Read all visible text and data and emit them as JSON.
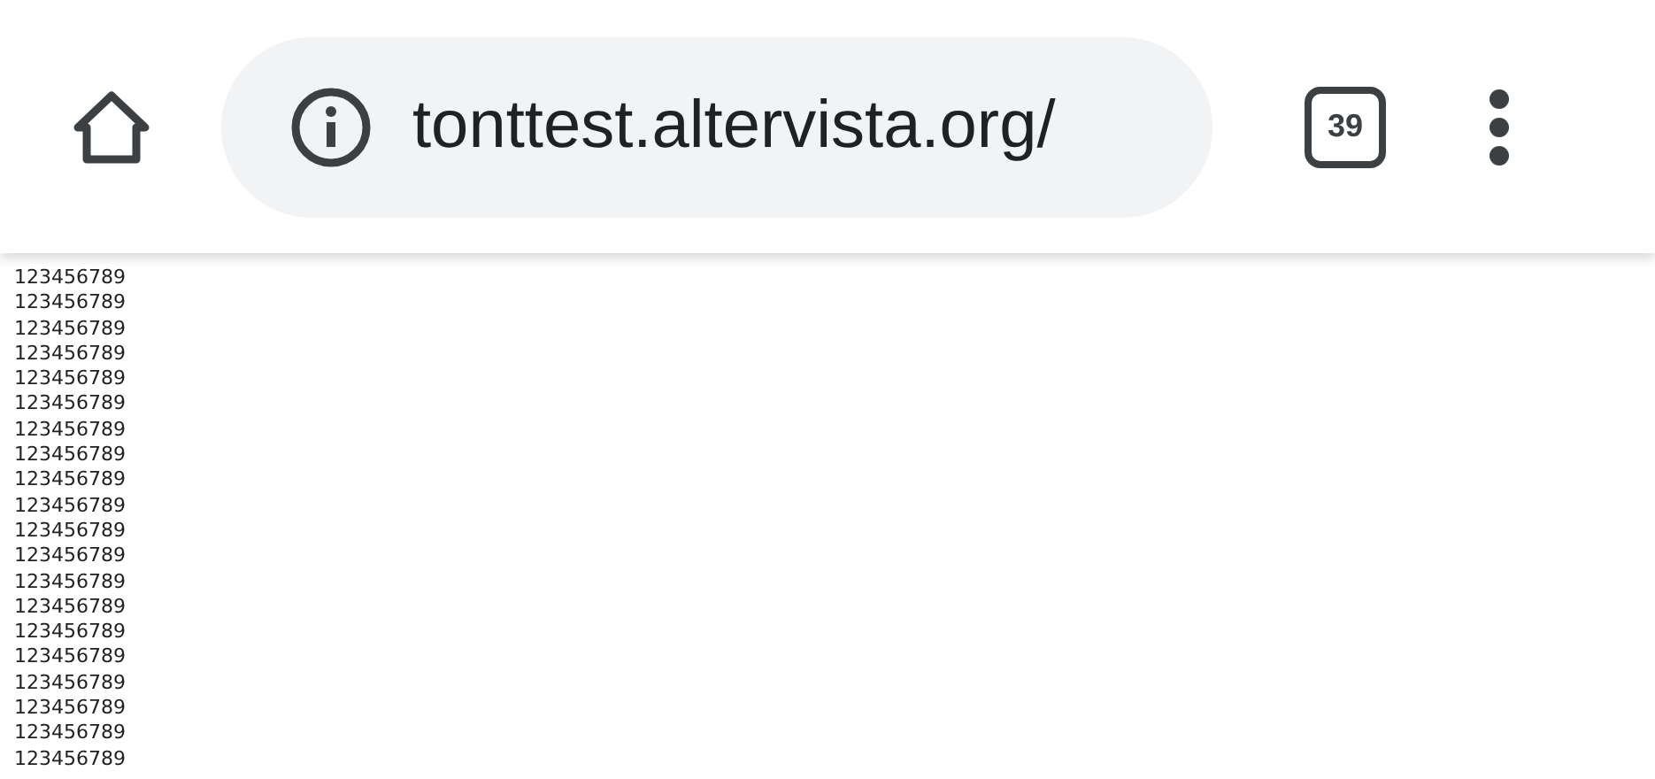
{
  "toolbar": {
    "url": "tonttest.altervista.org/",
    "tab_count": "39"
  },
  "lines": [
    "123456789",
    "123456789",
    "123456789",
    "123456789",
    "123456789",
    "123456789",
    "123456789",
    "123456789",
    "123456789",
    "123456789",
    "123456789",
    "123456789",
    "123456789",
    "123456789",
    "123456789",
    "123456789",
    "123456789",
    "123456789",
    "123456789",
    "123456789"
  ]
}
